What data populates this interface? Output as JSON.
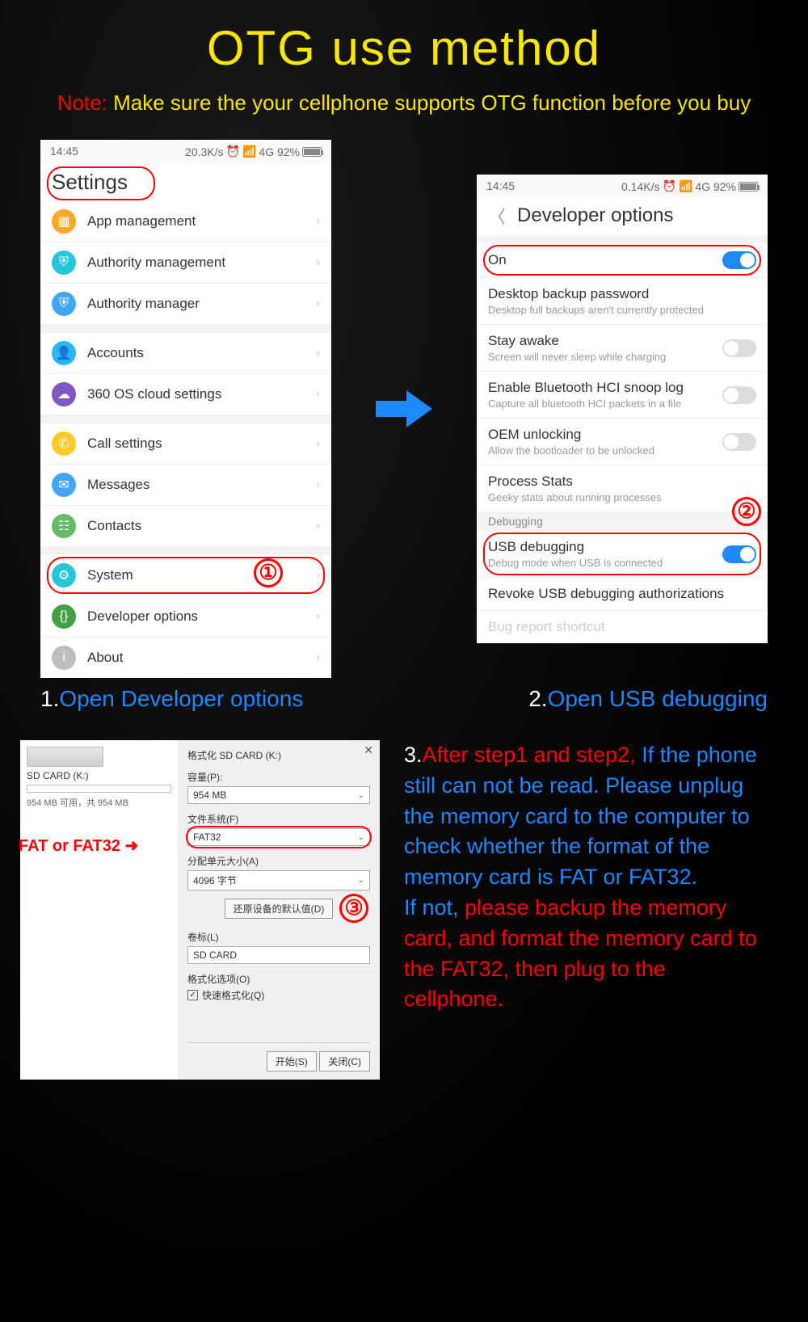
{
  "title": "OTG use method",
  "note_prefix": "Note: ",
  "note_text": "Make sure the your cellphone supports OTG function before you buy",
  "status": {
    "time": "14:45",
    "speed1": "20.3K/s",
    "speed2": "0.14K/s",
    "net": "4G 92%"
  },
  "phone1": {
    "header": "Settings",
    "groups": [
      [
        {
          "icon": "orange",
          "glyph": "▦",
          "label": "App management"
        },
        {
          "icon": "teal",
          "glyph": "⛨",
          "label": "Authority management"
        },
        {
          "icon": "blue",
          "glyph": "⛨",
          "label": "Authority manager"
        }
      ],
      [
        {
          "icon": "blue2",
          "glyph": "👤",
          "label": "Accounts"
        },
        {
          "icon": "purple",
          "glyph": "☁",
          "label": "360 OS cloud settings"
        }
      ],
      [
        {
          "icon": "yellow",
          "glyph": "✆",
          "label": "Call settings"
        },
        {
          "icon": "blue3",
          "glyph": "✉",
          "label": "Messages"
        },
        {
          "icon": "green",
          "glyph": "☷",
          "label": "Contacts"
        }
      ],
      [
        {
          "icon": "cyan",
          "glyph": "⚙",
          "label": "System",
          "circled": true,
          "num": "①"
        },
        {
          "icon": "green2",
          "glyph": "{}",
          "label": "Developer options"
        },
        {
          "icon": "grey",
          "glyph": "i",
          "label": "About"
        }
      ]
    ]
  },
  "phone2": {
    "header": "Developer options",
    "rows": [
      {
        "label": "On",
        "toggle": "on",
        "circled": true
      },
      {
        "label": "Desktop backup password",
        "sub": "Desktop full backups aren't currently protected"
      },
      {
        "label": "Stay awake",
        "sub": "Screen will never sleep while charging",
        "toggle": "off"
      },
      {
        "label": "Enable Bluetooth HCI snoop log",
        "sub": "Capture all bluetooth HCI packets in a file",
        "toggle": "off"
      },
      {
        "label": "OEM unlocking",
        "sub": "Allow the bootloader to be unlocked",
        "toggle": "off"
      },
      {
        "label": "Process Stats",
        "sub": "Geeky stats about running processes"
      }
    ],
    "debug_label": "Debugging",
    "debug_num": "②",
    "rows2": [
      {
        "label": "USB debugging",
        "sub": "Debug mode when USB is connected",
        "toggle": "on",
        "circled": true
      },
      {
        "label": "Revoke USB debugging authorizations"
      },
      {
        "label": "Bug report shortcut",
        "faded": true
      }
    ]
  },
  "cap1_num": "1.",
  "cap1": "Open Developer options",
  "cap2_num": "2.",
  "cap2": "Open USB debugging",
  "win": {
    "drive_title": "SD CARD (K:)",
    "drive_sub": "954 MB 可用，共 954 MB",
    "dialog_title": "格式化 SD CARD (K:)",
    "capacity_label": "容量(P):",
    "capacity_val": "954 MB",
    "fs_label": "文件系统(F)",
    "fs_val": "FAT32",
    "alloc_label": "分配单元大小(A)",
    "alloc_val": "4096 字节",
    "restore_btn": "还原设备的默认值(D)",
    "vol_label": "卷标(L)",
    "vol_val": "SD CARD",
    "fmt_opt_label": "格式化选项(O)",
    "quick_fmt": "快速格式化(Q)",
    "start_btn": "开始(S)",
    "close_btn": "关闭(C)",
    "num": "③",
    "fat_hint": "FAT or FAT32  ➜"
  },
  "step3": {
    "n": "3.",
    "line1": "After step1 and step2,",
    "line2": "If the phone still can not be read. Please unplug the memory card to the computer to check whether the format of the memory card is FAT or FAT32.",
    "line3a": "If not, ",
    "line3b": "please backup the memory card, and format the memory card to the FAT32, then plug to the cellphone."
  }
}
